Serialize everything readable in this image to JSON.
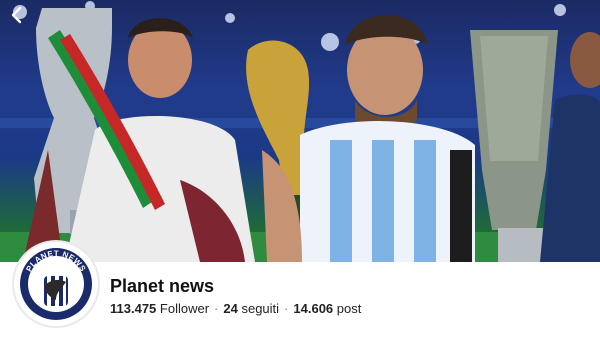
{
  "profile": {
    "name": "Planet news",
    "followers_count": "113.475",
    "followers_label": "Follower",
    "following_count": "24",
    "following_label": "seguiti",
    "posts_count": "14.606",
    "posts_label": "post",
    "separator": "·",
    "avatar_text": "PLANET NEWS"
  },
  "icons": {
    "back": "chevron-left-icon"
  },
  "colors": {
    "cover_sky": "#1f3a8a",
    "pitch": "#2c8a3e",
    "avatar_ring": "#1b2a6b",
    "text": "#111111"
  }
}
